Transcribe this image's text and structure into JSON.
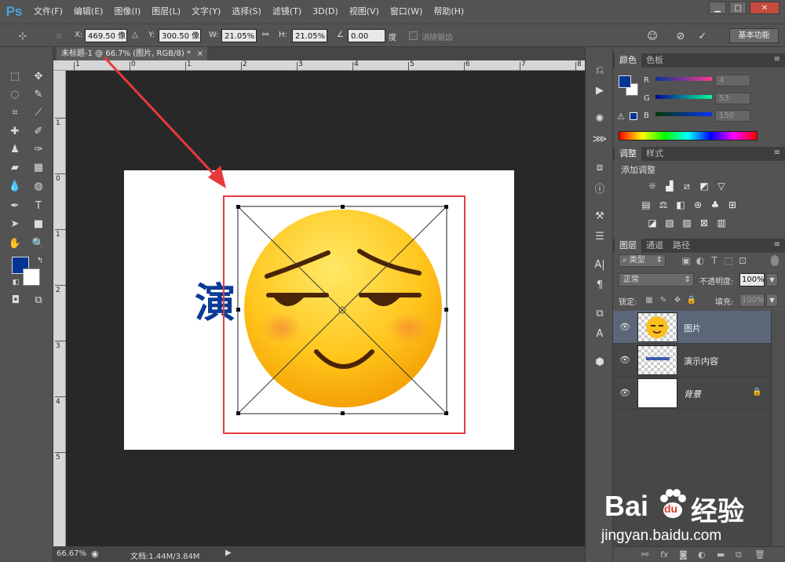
{
  "app": {
    "logo": "Ps"
  },
  "menu": [
    "文件(F)",
    "编辑(E)",
    "图像(I)",
    "图层(L)",
    "文字(Y)",
    "选择(S)",
    "滤镜(T)",
    "3D(D)",
    "视图(V)",
    "窗口(W)",
    "帮助(H)"
  ],
  "window_controls": {
    "minimize": "▁",
    "maximize": "□",
    "close": "✕"
  },
  "options": {
    "x_label": "X:",
    "x_value": "469.50 像",
    "y_label": "Y:",
    "y_value": "300.50 像",
    "w_label": "W:",
    "w_value": "21.05%",
    "h_label": "H:",
    "h_value": "21.05%",
    "angle_value": "0.00",
    "angle_unit": "度",
    "antialias_label": "消除锯齿",
    "workspace": "基本功能"
  },
  "document": {
    "tab_title": "未标题-1 @ 66.7% (图片, RGB/8) *",
    "canvas_text": "演",
    "zoom": "66.67%",
    "doc_size": "文档:1.44M/3.84M"
  },
  "ruler_top_labels": [
    "1",
    "0",
    "1",
    "2",
    "3",
    "4",
    "5",
    "6",
    "7",
    "8"
  ],
  "ruler_left_labels": [
    "1",
    "0",
    "1",
    "2",
    "3",
    "4",
    "5"
  ],
  "color_panel": {
    "tabs": [
      "颜色",
      "色板"
    ],
    "r_label": "R",
    "r_value": "4",
    "g_label": "G",
    "g_value": "53",
    "b_label": "B",
    "b_value": "150",
    "foreground": "#043596"
  },
  "adjust_panel": {
    "tabs": [
      "调整",
      "样式"
    ],
    "title": "添加调整"
  },
  "layers_panel": {
    "tabs": [
      "图层",
      "通道",
      "路径"
    ],
    "filter_label": "类型",
    "blend_mode": "正常",
    "opacity_label": "不透明度:",
    "opacity_value": "100%",
    "lock_label": "锁定:",
    "fill_label": "填充:",
    "fill_value": "100%",
    "layers": [
      {
        "name": "图片"
      },
      {
        "name": "演示内容"
      },
      {
        "name": "背景"
      }
    ]
  },
  "watermark": {
    "brand": "Bai",
    "brand2": "du",
    "cn": "经验",
    "url": "jingyan.baidu.com"
  }
}
